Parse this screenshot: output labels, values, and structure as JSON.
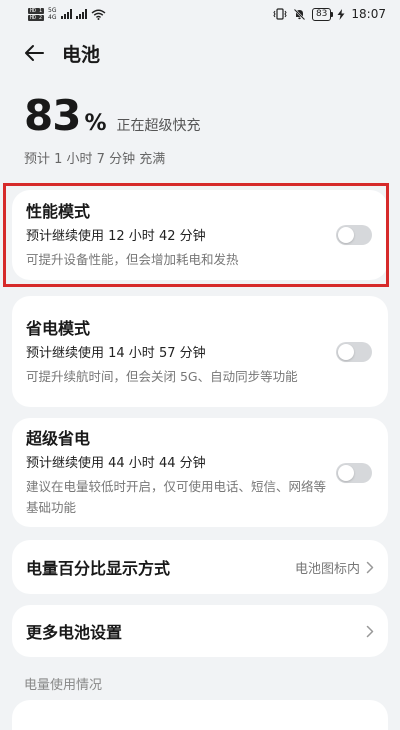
{
  "status_bar": {
    "sim1": "HD 1",
    "sim2": "HD 2",
    "net1": "5G",
    "net2": "4G",
    "battery_level": "83",
    "time": "18:07"
  },
  "header": {
    "title": "电池"
  },
  "summary": {
    "percent": "83",
    "percent_sign": "%",
    "status": "正在超级快充",
    "estimate": "预计 1 小时 7 分钟 充满"
  },
  "modes": [
    {
      "title": "性能模式",
      "usage": "预计继续使用 12 小时 42 分钟",
      "desc": "可提升设备性能，但会增加耗电和发热",
      "enabled": false
    },
    {
      "title": "省电模式",
      "usage": "预计继续使用 14 小时 57 分钟",
      "desc": "可提升续航时间，但会关闭 5G、自动同步等功能",
      "enabled": false
    },
    {
      "title": "超级省电",
      "usage": "预计继续使用 44 小时 44 分钟",
      "desc": "建议在电量较低时开启，仅可使用电话、短信、网络等基础功能",
      "enabled": false
    }
  ],
  "settings": {
    "percent_display_label": "电量百分比显示方式",
    "percent_display_value": "电池图标内",
    "more_settings_label": "更多电池设置"
  },
  "section": {
    "usage_label": "电量使用情况"
  },
  "colors": {
    "background": "#f1f3f5",
    "card": "#ffffff",
    "highlight": "#d62a2a",
    "toggle_off": "#d6d8db"
  }
}
